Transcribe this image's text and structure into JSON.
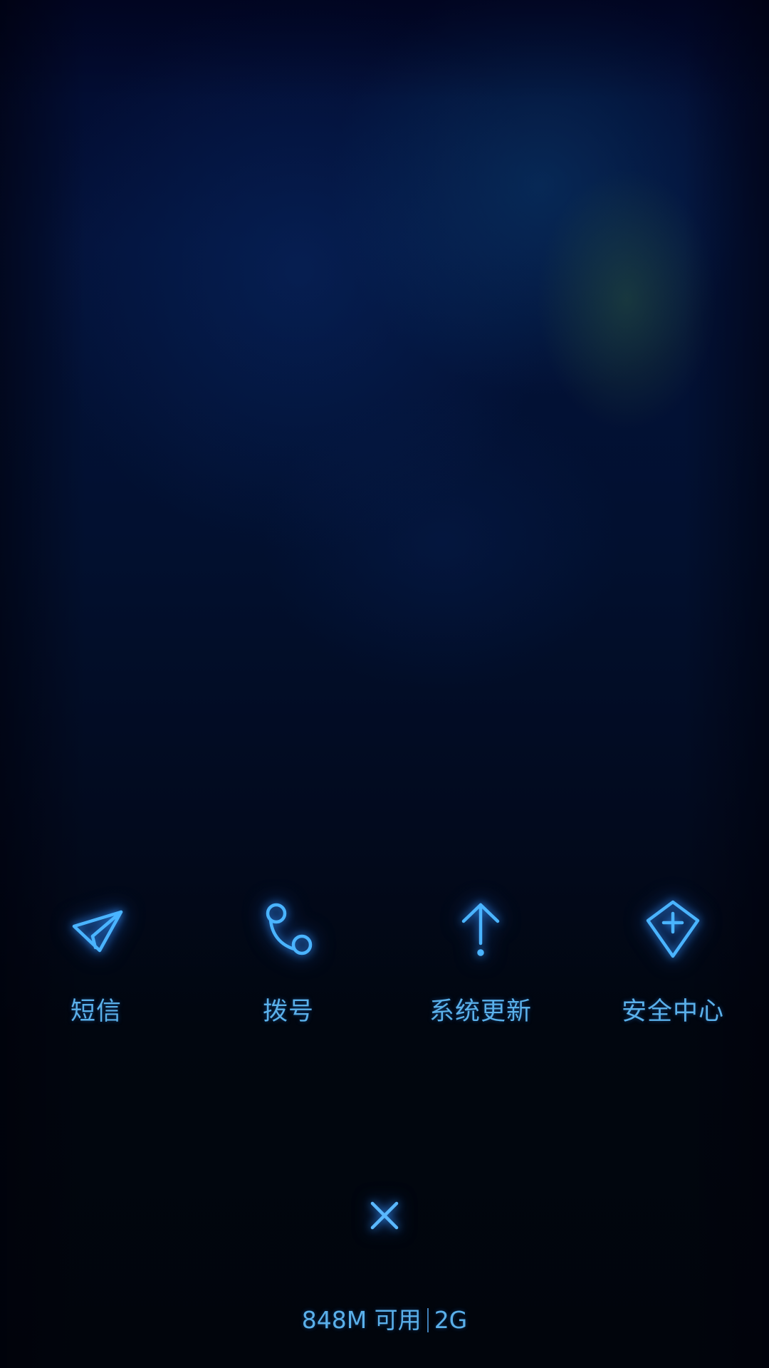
{
  "apps": [
    {
      "label": "短信",
      "icon": "paper-plane-icon"
    },
    {
      "label": "拨号",
      "icon": "phone-icon"
    },
    {
      "label": "系统更新",
      "icon": "arrow-up-icon"
    },
    {
      "label": "安全中心",
      "icon": "shield-plus-icon"
    }
  ],
  "close": {
    "icon": "close-icon"
  },
  "memory": {
    "available": "848M 可用",
    "total": "2G"
  },
  "colors": {
    "accent": "#4ab4ff",
    "label": "#5ab0ea",
    "background": "#020a1e"
  }
}
